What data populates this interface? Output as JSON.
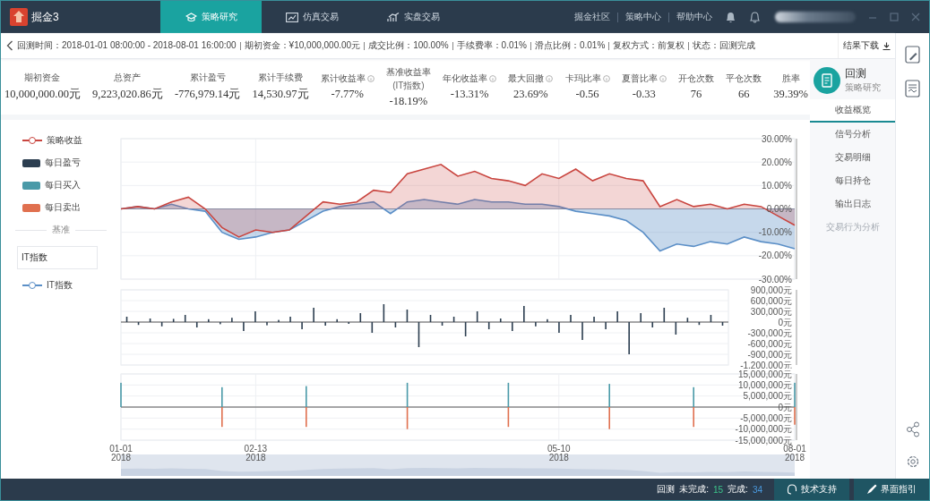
{
  "app": {
    "name": "掘金3"
  },
  "nav_tabs": [
    {
      "label": "策略研究",
      "selected": true,
      "kind": "cap"
    },
    {
      "label": "仿真交易",
      "selected": false,
      "kind": "chart"
    },
    {
      "label": "实盘交易",
      "selected": false,
      "kind": "bars"
    }
  ],
  "header_links": [
    "掘金社区",
    "策略中心",
    "帮助中心"
  ],
  "info_bar": {
    "items": [
      "回测时间：2018-01-01 08:00:00 - 2018-08-01 16:00:00",
      "期初资金：¥10,000,000.00元",
      "成交比例：100.00%",
      "手续费率：0.01%",
      "滑点比例：0.01%",
      "复权方式：前复权",
      "状态：回测完成"
    ],
    "download_button": "结果下载"
  },
  "stats": [
    {
      "label": "期初资金",
      "value": "10,000,000.00元",
      "info": false
    },
    {
      "label": "总资产",
      "value": "9,223,020.86元",
      "info": false
    },
    {
      "label": "累计盈亏",
      "value": "-776,979.14元",
      "info": false
    },
    {
      "label": "累计手续费",
      "value": "14,530.97元",
      "info": false
    },
    {
      "label": "累计收益率",
      "value": "-7.77%",
      "info": true
    },
    {
      "label": "基准收益率",
      "sublabel": "(IT指数)",
      "value": "-18.19%",
      "info": false
    },
    {
      "label": "年化收益率",
      "value": "-13.31%",
      "info": true
    },
    {
      "label": "最大回撤",
      "value": "23.69%",
      "info": true
    },
    {
      "label": "卡玛比率",
      "value": "-0.56",
      "info": true
    },
    {
      "label": "夏普比率",
      "value": "-0.33",
      "info": true
    },
    {
      "label": "开仓次数",
      "value": "76",
      "info": false
    },
    {
      "label": "平仓次数",
      "value": "66",
      "info": false
    },
    {
      "label": "胜率",
      "value": "39.39%",
      "info": false
    }
  ],
  "side_panel": {
    "title": "回测",
    "subtitle": "策略研究",
    "menu": [
      {
        "label": "收益概览",
        "selected": true,
        "disabled": false
      },
      {
        "label": "信号分析",
        "selected": false,
        "disabled": false
      },
      {
        "label": "交易明细",
        "selected": false,
        "disabled": false
      },
      {
        "label": "每日持仓",
        "selected": false,
        "disabled": false
      },
      {
        "label": "输出日志",
        "selected": false,
        "disabled": false
      },
      {
        "label": "交易行为分析",
        "selected": false,
        "disabled": true
      }
    ]
  },
  "legend": {
    "benchmark_title": "基准",
    "benchmark_select": "IT指数"
  },
  "returns_chart": {
    "chart_data": {
      "type": "area",
      "grid": true,
      "ylim": [
        -30,
        30
      ],
      "yticks": [
        {
          "value": 30,
          "label": "30.00%"
        },
        {
          "value": 20,
          "label": "20.00%"
        },
        {
          "value": 10,
          "label": "10.00%"
        },
        {
          "value": 0,
          "label": "0.00%"
        },
        {
          "value": -10,
          "label": "-10.00%"
        },
        {
          "value": -20,
          "label": "-20.00%"
        },
        {
          "value": -30,
          "label": "-30.00%"
        }
      ],
      "series": [
        {
          "name": "策略收益",
          "color": "#c9453f",
          "values": [
            0,
            1,
            0,
            3,
            5,
            0,
            -8,
            -12,
            -9,
            -10,
            -9,
            -3,
            3,
            2,
            3,
            8,
            7,
            15,
            17,
            19,
            14,
            16,
            13,
            12,
            10,
            15,
            13,
            17,
            12,
            15,
            13,
            12,
            1,
            4,
            1,
            2,
            0,
            2,
            1,
            -3,
            -7
          ]
        },
        {
          "name": "IT指数",
          "color": "#5b8fc7",
          "values": [
            0,
            1,
            0,
            2,
            0,
            -1,
            -10,
            -13,
            -12,
            -10,
            -9,
            -5,
            -1,
            1,
            2,
            3,
            -2,
            3,
            4,
            3,
            2,
            4,
            3,
            3,
            2,
            2,
            1,
            -1,
            -2,
            -3,
            -5,
            -10,
            -18,
            -15,
            -16,
            -14,
            -15,
            -12,
            -14,
            -15,
            -17
          ]
        }
      ]
    }
  },
  "pnl_chart": {
    "chart_data": {
      "type": "bar",
      "grid": true,
      "ylim": [
        -1200000,
        900000
      ],
      "yticks": [
        {
          "value": 900000,
          "label": "900,000元"
        },
        {
          "value": 600000,
          "label": "600,000元"
        },
        {
          "value": 300000,
          "label": "300,000元"
        },
        {
          "value": 0,
          "label": "0元"
        },
        {
          "value": -300000,
          "label": "-300,000元"
        },
        {
          "value": -600000,
          "label": "-600,000元"
        },
        {
          "value": -900000,
          "label": "-900,000元"
        },
        {
          "value": -1200000,
          "label": "-1,200,000元"
        }
      ],
      "series": [
        {
          "name": "每日盈亏",
          "color": "#2c3e50",
          "values": [
            150000,
            -80000,
            100000,
            -120000,
            90000,
            200000,
            -150000,
            80000,
            -60000,
            120000,
            -250000,
            300000,
            -90000,
            60000,
            150000,
            -200000,
            400000,
            -100000,
            80000,
            -50000,
            250000,
            -300000,
            500000,
            -150000,
            350000,
            -700000,
            200000,
            -100000,
            150000,
            -400000,
            300000,
            -200000,
            100000,
            -250000,
            450000,
            -120000,
            80000,
            -300000,
            200000,
            -500000,
            150000,
            -200000,
            300000,
            -900000,
            250000,
            -150000,
            400000,
            -350000,
            120000,
            -80000,
            200000,
            -100000
          ]
        }
      ]
    }
  },
  "trades_chart": {
    "chart_data": {
      "type": "bar",
      "grid": true,
      "ylim": [
        -15000000,
        15000000
      ],
      "categories": [
        "01-01 2018",
        null,
        null,
        null,
        null,
        null,
        null,
        null,
        "02-13 2018",
        null,
        null,
        null,
        null,
        null,
        null,
        null,
        null,
        null,
        null,
        null,
        null,
        null,
        null,
        null,
        null,
        null,
        "05-10 2018",
        null,
        null,
        null,
        null,
        null,
        null,
        null,
        null,
        null,
        null,
        null,
        null,
        null,
        "08-01 2018"
      ],
      "yticks": [
        {
          "value": 15000000,
          "label": "15,000,000元"
        },
        {
          "value": 10000000,
          "label": "10,000,000元"
        },
        {
          "value": 5000000,
          "label": "5,000,000元"
        },
        {
          "value": 0,
          "label": "0元"
        },
        {
          "value": -5000000,
          "label": "-5,000,000元"
        },
        {
          "value": -10000000,
          "label": "-10,000,000元"
        },
        {
          "value": -15000000,
          "label": "-15,000,000元"
        }
      ],
      "series": [
        {
          "name": "每日买入",
          "color": "#4a9aa8",
          "values": [
            11000000,
            null,
            null,
            null,
            null,
            null,
            9000000,
            null,
            null,
            null,
            null,
            9500000,
            null,
            null,
            null,
            null,
            null,
            11000000,
            null,
            null,
            null,
            null,
            null,
            11000000,
            null,
            null,
            null,
            null,
            null,
            10500000,
            null,
            null,
            null,
            null,
            9000000,
            null,
            null,
            null,
            null,
            null,
            11000000
          ]
        },
        {
          "name": "每日卖出",
          "color": "#e0704f",
          "values": [
            null,
            null,
            null,
            null,
            null,
            null,
            -9000000,
            null,
            null,
            null,
            null,
            -9000000,
            null,
            null,
            null,
            null,
            null,
            -10000000,
            null,
            null,
            null,
            null,
            null,
            -9000000,
            null,
            null,
            null,
            null,
            null,
            -10000000,
            null,
            null,
            null,
            null,
            -9000000,
            null,
            null,
            null,
            null,
            null,
            -8000000
          ]
        }
      ]
    }
  },
  "status_bar": {
    "mode": "回测",
    "pending_label": "未完成:",
    "pending": "15",
    "done_label": "完成:",
    "done": "34",
    "support": "技术支持",
    "guide": "界面指引"
  }
}
